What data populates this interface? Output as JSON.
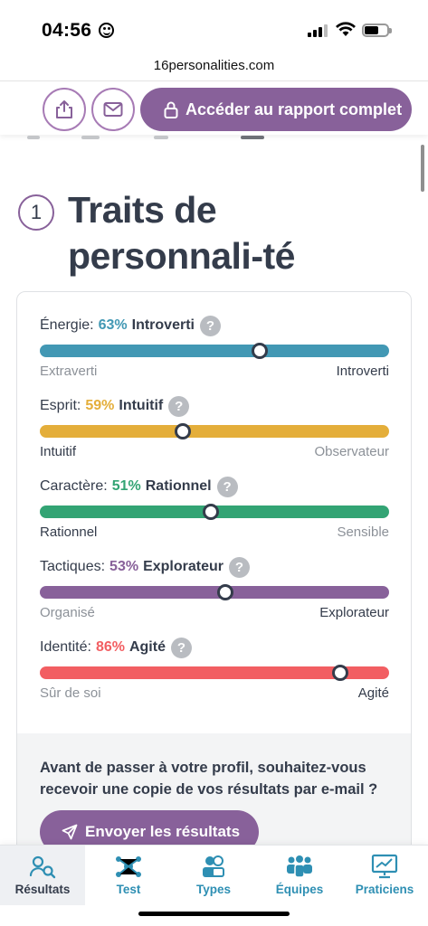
{
  "status_bar": {
    "time": "04:56"
  },
  "browser": {
    "url": "16personalities.com"
  },
  "actions": {
    "report_button": "Accéder au rapport complet"
  },
  "section": {
    "number": "1",
    "title": "Traits de personnali-té"
  },
  "traits": [
    {
      "label": "Énergie:",
      "percent": "63%",
      "name": "Introverti",
      "value": 63,
      "color": "#4298b4",
      "left_label": "Extraverti",
      "right_label": "Introverti",
      "active_side": "right"
    },
    {
      "label": "Esprit:",
      "percent": "59%",
      "name": "Intuitif",
      "value": 41,
      "color": "#e4ae3a",
      "left_label": "Intuitif",
      "right_label": "Observateur",
      "active_side": "left"
    },
    {
      "label": "Caractère:",
      "percent": "51%",
      "name": "Rationnel",
      "value": 49,
      "color": "#33a474",
      "left_label": "Rationnel",
      "right_label": "Sensible",
      "active_side": "left"
    },
    {
      "label": "Tactiques:",
      "percent": "53%",
      "name": "Explorateur",
      "value": 53,
      "color": "#88619a",
      "left_label": "Organisé",
      "right_label": "Explorateur",
      "active_side": "right"
    },
    {
      "label": "Identité:",
      "percent": "86%",
      "name": "Agité",
      "value": 86,
      "color": "#f25e62",
      "left_label": "Sûr de soi",
      "right_label": "Agité",
      "active_side": "right"
    }
  ],
  "email_prompt": {
    "text": "Avant de passer à votre profil, souhaitez-vous recevoir une copie de vos résultats par e-mail ?",
    "button": "Envoyer les résultats"
  },
  "bottom_nav": [
    {
      "label": "Résultats",
      "icon": "results-search-icon",
      "active": true
    },
    {
      "label": "Test",
      "icon": "network-icon",
      "active": false
    },
    {
      "label": "Types",
      "icon": "types-people-icon",
      "active": false
    },
    {
      "label": "Équipes",
      "icon": "teams-icon",
      "active": false
    },
    {
      "label": "Praticiens",
      "icon": "chart-board-icon",
      "active": false
    }
  ],
  "colors": {
    "accent": "#88619a",
    "text": "#343c4b",
    "nav_link": "#2e8fb3"
  }
}
